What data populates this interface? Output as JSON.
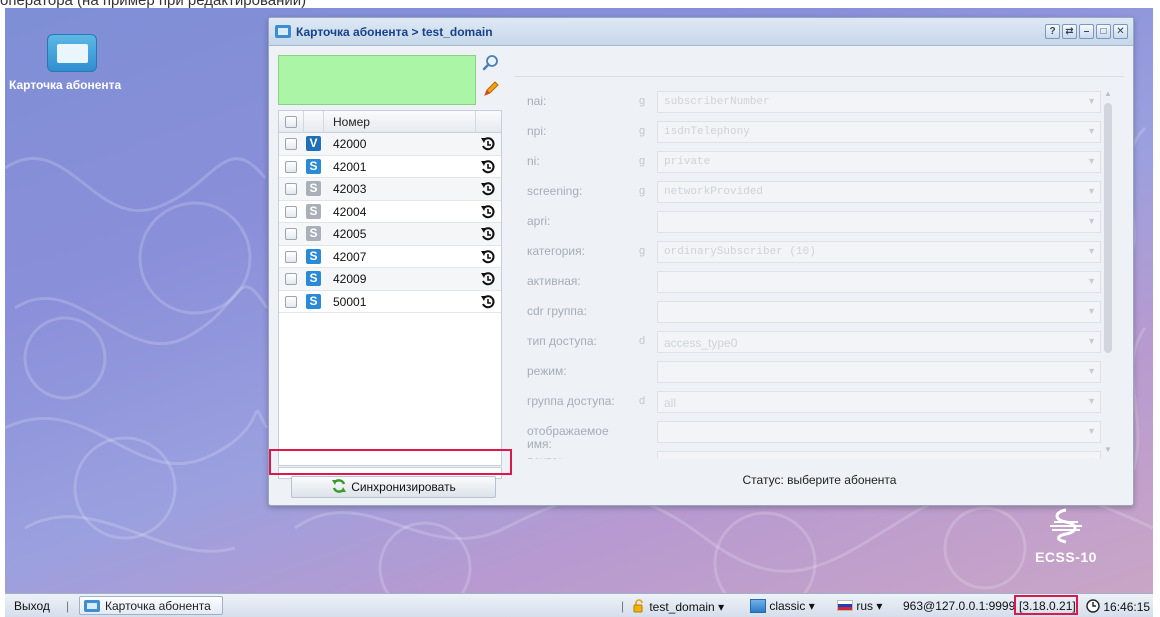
{
  "caption_text": "оператора (на пример при редактировании)",
  "desktop": {
    "shortcut_label": "Карточка абонента"
  },
  "window": {
    "title": "Карточка абонента > test_domain",
    "buttons": [
      "?",
      "⇄",
      "–",
      "□",
      "✕"
    ]
  },
  "list": {
    "column_header": "Номер",
    "rows": [
      {
        "type": "V",
        "number": "42000"
      },
      {
        "type": "S",
        "number": "42001"
      },
      {
        "type": "G",
        "number": "42003"
      },
      {
        "type": "G",
        "number": "42004"
      },
      {
        "type": "G",
        "number": "42005"
      },
      {
        "type": "S",
        "number": "42007"
      },
      {
        "type": "S",
        "number": "42009"
      },
      {
        "type": "S",
        "number": "50001"
      }
    ],
    "sync_button": "Синхронизировать"
  },
  "form": {
    "fields": [
      {
        "label": "nai:",
        "mark": "g",
        "value": "subscriberNumber"
      },
      {
        "label": "npi:",
        "mark": "g",
        "value": "isdnTelephony"
      },
      {
        "label": "ni:",
        "mark": "g",
        "value": "private"
      },
      {
        "label": "screening:",
        "mark": "g",
        "value": "networkProvided"
      },
      {
        "label": "apri:",
        "mark": "",
        "value": ""
      },
      {
        "label": "категория:",
        "mark": "g",
        "value": "ordinarySubscriber (10)"
      },
      {
        "label": "активная:",
        "mark": "",
        "value": ""
      },
      {
        "label": "cdr группа:",
        "mark": "",
        "value": ""
      },
      {
        "label": "тип доступа:",
        "mark": "d",
        "value": "access_type0"
      },
      {
        "label": "режим:",
        "mark": "",
        "value": ""
      },
      {
        "label": "группа доступа:",
        "mark": "d",
        "value": "all"
      },
      {
        "label": "отображаемое имя:",
        "mark": "",
        "value": ""
      },
      {
        "label": "почта:",
        "mark": "",
        "value": ""
      }
    ],
    "status": "Статус: выберите абонента"
  },
  "logo": {
    "text": "ECSS-10"
  },
  "taskbar": {
    "exit": "Выход",
    "app_button": "Карточка абонента",
    "domain": "test_domain",
    "theme": "classic",
    "language": "rus",
    "connection": "963@127.0.0.1:9999",
    "version": "[3.18.0.21]",
    "time": "16:46:15"
  },
  "colors": {
    "filter_background": "#aaf5a6",
    "highlight_frame": "#e0174c",
    "title_text": "#15428b"
  }
}
